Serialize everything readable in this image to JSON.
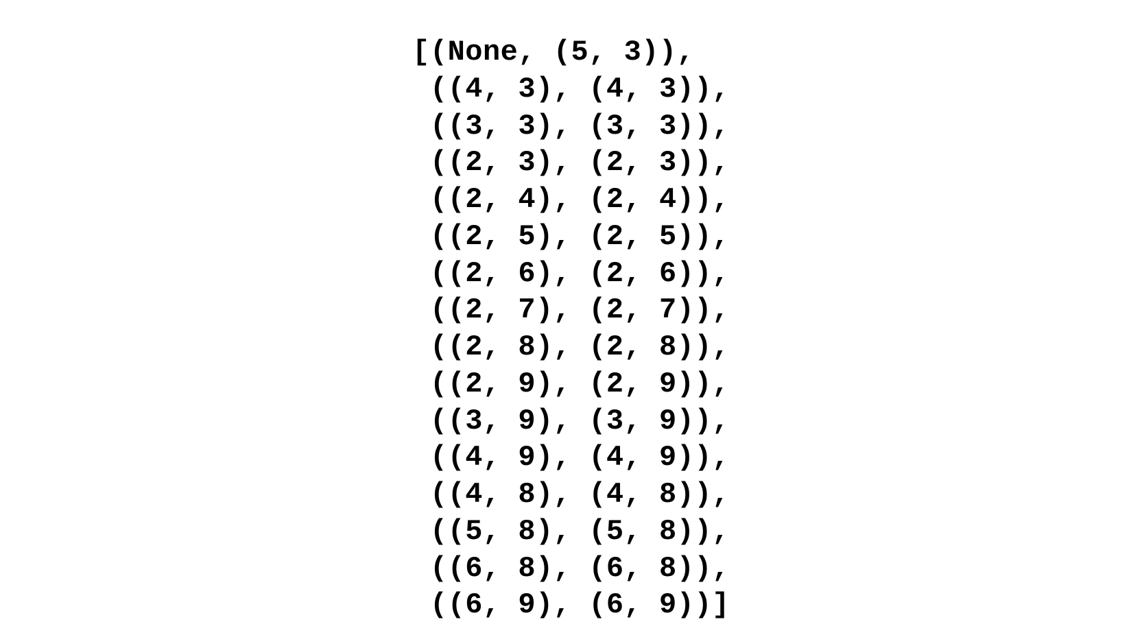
{
  "code": {
    "lines": [
      "[(None, (5, 3)),",
      " ((4, 3), (4, 3)),",
      " ((3, 3), (3, 3)),",
      " ((2, 3), (2, 3)),",
      " ((2, 4), (2, 4)),",
      " ((2, 5), (2, 5)),",
      " ((2, 6), (2, 6)),",
      " ((2, 7), (2, 7)),",
      " ((2, 8), (2, 8)),",
      " ((2, 9), (2, 9)),",
      " ((3, 9), (3, 9)),",
      " ((4, 9), (4, 9)),",
      " ((4, 8), (4, 8)),",
      " ((5, 8), (5, 8)),",
      " ((6, 8), (6, 8)),",
      " ((6, 9), (6, 9))]"
    ]
  }
}
